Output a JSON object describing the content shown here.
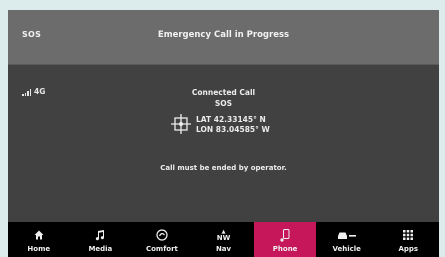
{
  "header": {
    "left": "SOS",
    "title": "Emergency Call in Progress"
  },
  "signal": {
    "network": "4G"
  },
  "call": {
    "status": "Connected Call",
    "type": "SOS",
    "lat": "LAT  42.33145° N",
    "lon": "LON  83.04585° W",
    "notice": "Call must be ended by operator."
  },
  "nav": {
    "items": [
      {
        "label": "Home",
        "icon": "home-icon"
      },
      {
        "label": "Media",
        "icon": "music-note-icon"
      },
      {
        "label": "Comfort",
        "icon": "comfort-icon"
      },
      {
        "label": "Nav",
        "icon": "compass-nw-icon",
        "icon_text": "NW"
      },
      {
        "label": "Phone",
        "icon": "phone-icon",
        "active": true
      },
      {
        "label": "Vehicle",
        "icon": "vehicle-icon"
      },
      {
        "label": "Apps",
        "icon": "apps-grid-icon"
      }
    ],
    "active_color": "#c5175a"
  }
}
